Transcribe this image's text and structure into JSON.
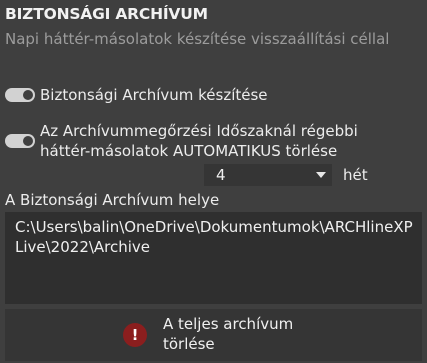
{
  "header": {
    "title": "BIZTONSÁGI ARCHÍVUM",
    "subtitle": "Napi háttér-másolatok készítése visszaállítási céllal"
  },
  "options": {
    "create_archive": {
      "label": "Biztonsági Archívum készítése",
      "checked": true
    },
    "auto_delete": {
      "label": "Az Archívummegőrzési Időszaknál régebbi háttér-másolatok AUTOMATIKUS törlése",
      "checked": true
    }
  },
  "retention": {
    "value": "4",
    "unit": "hét"
  },
  "location": {
    "label": "A Biztonsági Archívum helye",
    "path": "C:\\Users\\balin\\OneDrive\\Dokumentumok\\ARCHlineXP Live\\2022\\Archive"
  },
  "delete_all": {
    "label": "A teljes archívum törlése",
    "icon": "warning-exclamation-icon",
    "icon_glyph": "!"
  },
  "colors": {
    "background": "#3f3f3f",
    "field": "#2f2f2f",
    "warning": "#8b1e1e"
  }
}
